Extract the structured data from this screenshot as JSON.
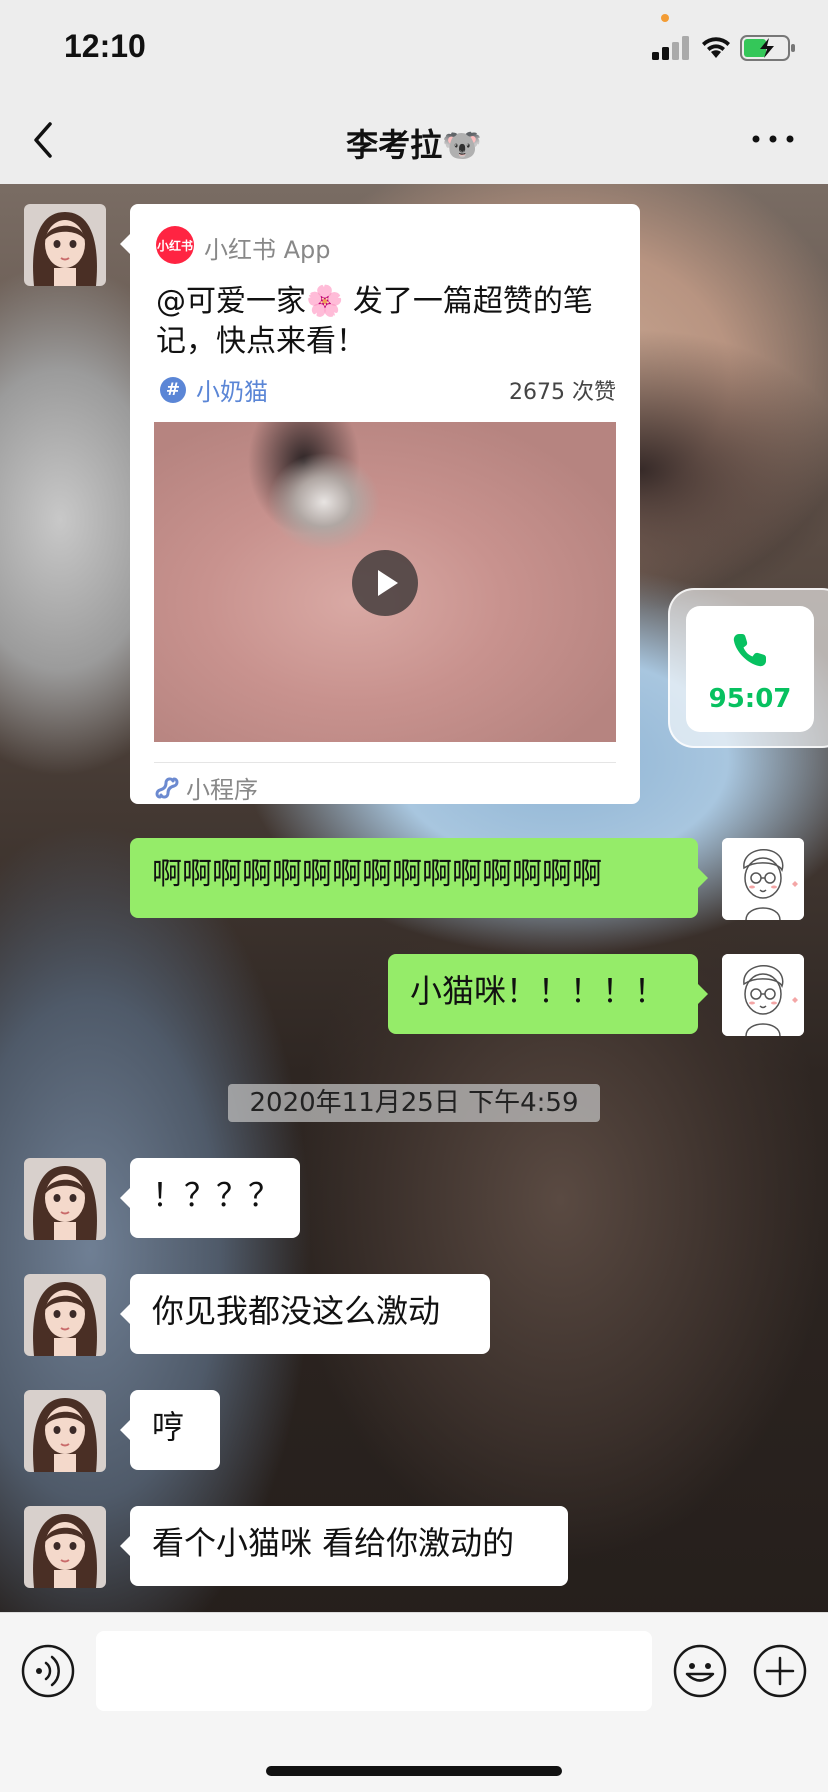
{
  "status_bar": {
    "time": "12:10"
  },
  "nav": {
    "title": "李考拉🐨",
    "back_icon": "chevron-left-icon",
    "more_icon": "ellipsis-icon"
  },
  "card": {
    "app_name": "小红书 App",
    "app_logo_text": "小红书",
    "title": "@可爱一家🌸 发了一篇超赞的笔记，快点来看！",
    "tag": "小奶猫",
    "tag_icon_text": "#",
    "likes": "2675 次赞",
    "footer_label": "小程序",
    "accent_color": "#ff2442"
  },
  "call_widget": {
    "duration": "95:07",
    "icon": "phone-icon",
    "color": "#07c160"
  },
  "messages_sent": [
    {
      "text": "啊啊啊啊啊啊啊啊啊啊啊啊啊啊啊"
    },
    {
      "text": "小猫咪！！！！！"
    }
  ],
  "timestamp": "2020年11月25日 下午4:59",
  "messages_received": [
    {
      "text": "！？？？"
    },
    {
      "text": "你见我都没这么激动"
    },
    {
      "text": "哼"
    },
    {
      "text": "看个小猫咪 看给你激动的"
    }
  ],
  "input_bar": {
    "value": "",
    "voice_icon": "voice-icon",
    "emoji_icon": "emoji-icon",
    "plus_icon": "plus-circle-icon"
  },
  "colors": {
    "sent_bubble": "#95ec69",
    "received_bubble": "#ffffff",
    "bar_background": "#ededed"
  }
}
